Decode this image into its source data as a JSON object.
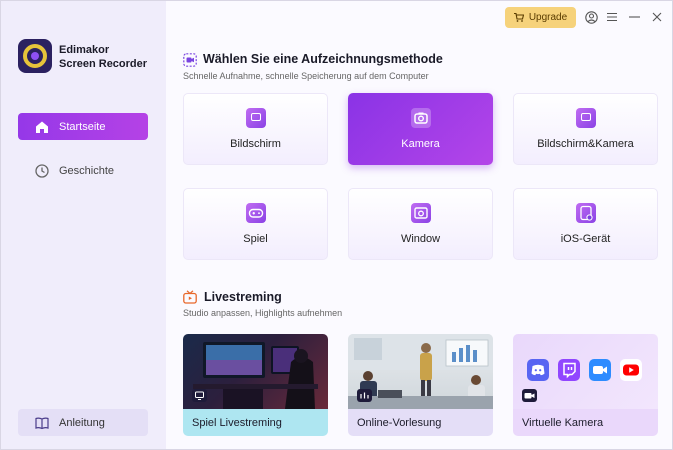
{
  "app": {
    "name_line1": "Edimakor",
    "name_line2": "Screen Recorder"
  },
  "topbar": {
    "upgrade_label": "Upgrade"
  },
  "sidebar": {
    "items": [
      {
        "label": "Startseite",
        "icon": "home-icon"
      },
      {
        "label": "Geschichte",
        "icon": "clock-icon"
      }
    ],
    "help": {
      "label": "Anleitung",
      "icon": "book-icon"
    }
  },
  "recording": {
    "title": "Wählen Sie eine Aufzeichnungsmethode",
    "subtitle": "Schnelle Aufnahme, schnelle Speicherung auf dem Computer",
    "methods": [
      {
        "label": "Bildschirm",
        "icon": "monitor-icon"
      },
      {
        "label": "Kamera",
        "icon": "camera-icon"
      },
      {
        "label": "Bildschirm&Kamera",
        "icon": "monitor-camera-icon"
      },
      {
        "label": "Spiel",
        "icon": "gamepad-icon"
      },
      {
        "label": "Window",
        "icon": "window-icon"
      },
      {
        "label": "iOS-Gerät",
        "icon": "ios-device-icon"
      }
    ]
  },
  "livestream": {
    "title": "Livestreming",
    "subtitle": "Studio anpassen, Highlights aufnehmen",
    "cards": [
      {
        "label": "Spiel Livestreming"
      },
      {
        "label": "Online-Vorlesung"
      },
      {
        "label": "Virtuelle Kamera"
      }
    ]
  },
  "colors": {
    "accent": "#9b3ce8",
    "upgrade": "#f6d27b",
    "sidebar": "#f0edfb"
  }
}
